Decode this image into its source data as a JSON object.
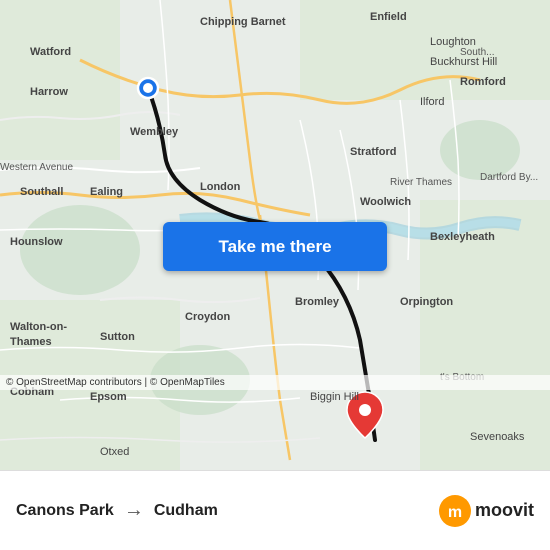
{
  "map": {
    "attribution": "© OpenStreetMap contributors | © OpenMapTiles",
    "button_label": "Take me there",
    "origin": "Canons Park",
    "destination": "Cudham",
    "arrow": "→"
  },
  "footer": {
    "from": "Canons Park",
    "to": "Cudham",
    "logo_text": "moovit",
    "arrow": "→"
  },
  "icons": {
    "moovit": "m",
    "arrow": "→"
  }
}
